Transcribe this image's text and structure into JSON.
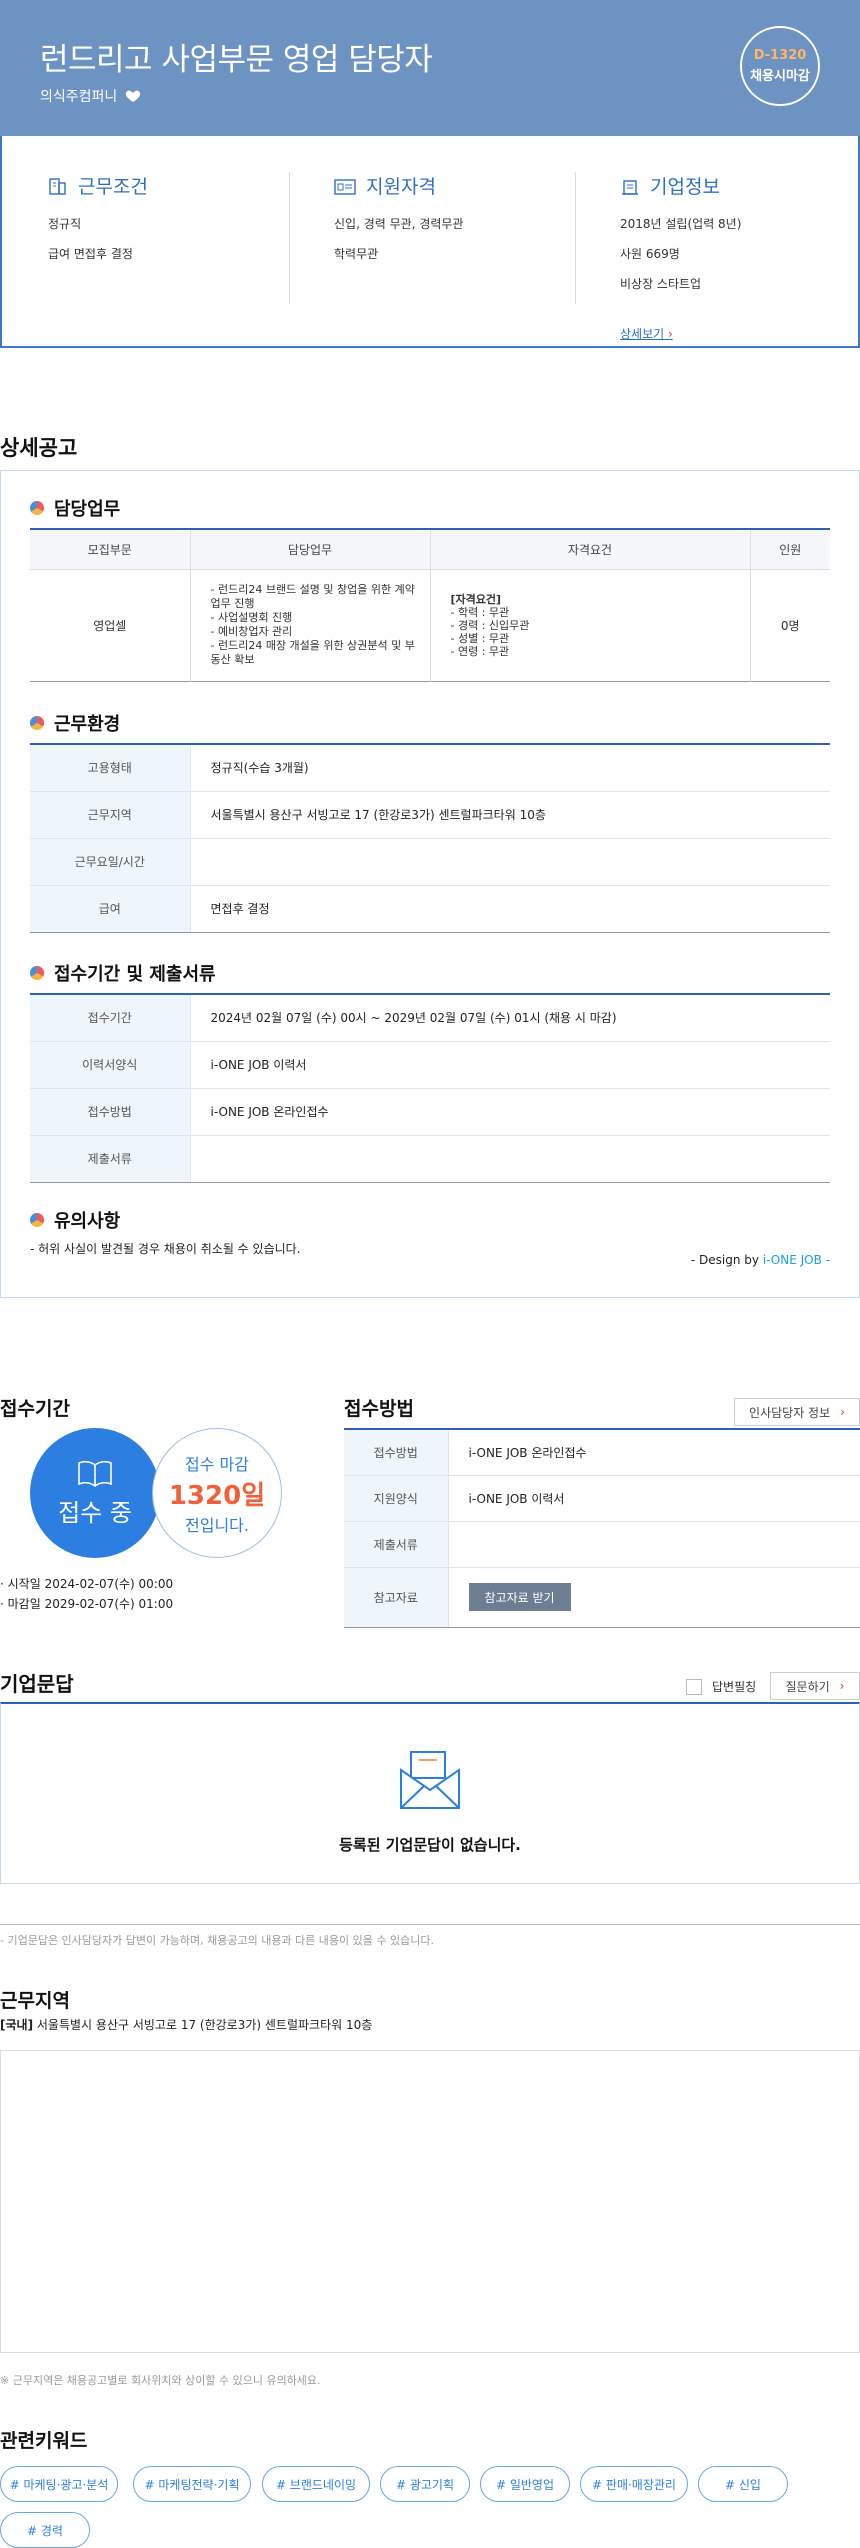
{
  "header": {
    "title": "런드리고 사업부문 영업 담당자",
    "company": "의식주컴퍼니",
    "dday": "D-1320",
    "dday_label": "채용시마감"
  },
  "summary": {
    "work": {
      "title": "근무조건",
      "lines": [
        "정규직",
        "급여 면접후 결정"
      ]
    },
    "qual": {
      "title": "지원자격",
      "lines": [
        "신입, 경력 무관, 경력무관",
        "학력무관"
      ]
    },
    "company": {
      "title": "기업정보",
      "lines": [
        "2018년 설립(업력 8년)",
        "사원 669명",
        "비상장 스타트업"
      ],
      "more": "상세보기"
    }
  },
  "detail": {
    "heading": "상세공고",
    "duty_title": "담당업무",
    "duty_headers": [
      "모집부문",
      "담당업무",
      "자격요건",
      "인원"
    ],
    "duty_row": {
      "dept": "영업셀",
      "tasks": [
        "- 런드리24 브랜드 설명 및 창업을 위한 계약업무 진행",
        "- 사업설명회 진행",
        "- 예비창업자 관리",
        "- 런드리24 매장 개설을 위한 상권분석 및 부동산 확보"
      ],
      "req_title": "[자격요건]",
      "req": [
        "- 학력 : 무관",
        "- 경력 : 신입무관",
        "- 성별 : 무관",
        "- 연령 : 무관"
      ],
      "count": "0명"
    },
    "env_title": "근무환경",
    "env": [
      {
        "k": "고용형태",
        "v": "정규직(수습 3개월)"
      },
      {
        "k": "근무지역",
        "v": "서울특별시 용산구 서빙고로 17 (한강로3가) 센트럴파크타워 10층"
      },
      {
        "k": "근무요일/시간",
        "v": ""
      },
      {
        "k": "급여",
        "v": "면접후 결정"
      }
    ],
    "apply_title": "접수기간 및 제출서류",
    "apply": [
      {
        "k": "접수기간",
        "v": "2024년 02월 07일 (수) 00시 ~ 2029년 02월 07일 (수) 01시 (채용 시 마감)"
      },
      {
        "k": "이력서양식",
        "v": "i-ONE JOB 이력서"
      },
      {
        "k": "접수방법",
        "v": "i-ONE JOB 온라인접수"
      },
      {
        "k": "제출서류",
        "v": ""
      }
    ],
    "notice_title": "유의사항",
    "notice": "- 허위 사실이 발견될 경우 채용이 취소될 수 있습니다.",
    "credit_prefix": "- Design by ",
    "credit_brand": "i-ONE JOB -"
  },
  "period": {
    "title": "접수기간",
    "status": "접수 중",
    "deadline_label": "접수 마감",
    "days_left": "1320일",
    "days_suffix": "전입니다.",
    "start": "시작일 2024-02-07(수) 00:00",
    "end": "마감일 2029-02-07(수) 01:00"
  },
  "method": {
    "title": "접수방법",
    "contact_btn": "인사담당자 정보",
    "rows": [
      {
        "k": "접수방법",
        "v": "i-ONE JOB 온라인접수"
      },
      {
        "k": "지원양식",
        "v": "i-ONE JOB 이력서"
      },
      {
        "k": "제출서류",
        "v": ""
      },
      {
        "k": "참고자료"
      }
    ],
    "ref_btn": "참고자료 받기"
  },
  "qa": {
    "title": "기업문답",
    "answered_only": "답변필칭",
    "ask_btn": "질문하기",
    "empty": "등록된 기업문답이 없습니다.",
    "note": "- 기업문답은 인사담당자가 답변이 가능하며, 채용공고의 내용과 다른 내용이 있을 수 있습니다."
  },
  "location": {
    "title": "근무지역",
    "tag": "[국내]",
    "address": "서울특별시 용산구 서빙고로 17 (한강로3가) 센트럴파크타워 10층",
    "note": "※ 근무지역은 채용공고별로 회사위치와 상이할 수 있으니 유의하세요."
  },
  "keywords": {
    "title": "관련키워드",
    "items": [
      "# 마케팅·광고·분석",
      "# 마케팅전략·기획",
      "# 브랜드네이밍",
      "# 광고기획",
      "# 일반영업",
      "# 판매·매장관리",
      "# 신입",
      "# 경력"
    ]
  },
  "colors": {
    "hero": "#6d93c2",
    "accent": "#2c7fe0",
    "deadline": "#f0603a",
    "rule": "#2c61b3"
  }
}
